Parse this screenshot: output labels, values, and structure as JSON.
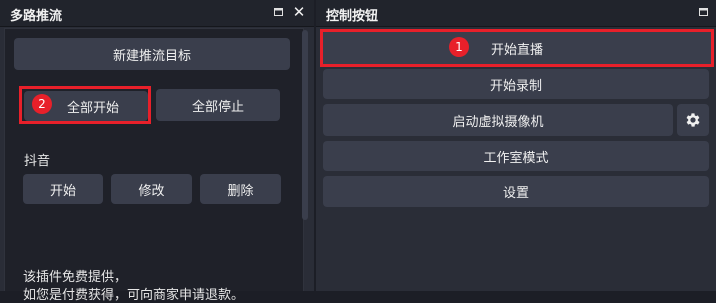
{
  "left_dock": {
    "title": "多路推流",
    "new_target_button": "新建推流目标",
    "start_all_button": "全部开始",
    "stop_all_button": "全部停止",
    "target_name": "抖音",
    "start_button": "开始",
    "edit_button": "修改",
    "delete_button": "删除",
    "footer_line1": "该插件免费提供，",
    "footer_line2": "如您是付费获得，可向商家申请退款。",
    "annotation_badge": "2"
  },
  "right_dock": {
    "title": "控制按钮",
    "start_streaming_button": "开始直播",
    "start_recording_button": "开始录制",
    "start_virtual_camera_button": "启动虚拟摄像机",
    "studio_mode_button": "工作室模式",
    "settings_button": "设置",
    "annotation_badge": "1"
  },
  "colors": {
    "highlight": "#e8202a",
    "button_bg": "#3a3e4c",
    "panel_bg": "#1f2129"
  }
}
